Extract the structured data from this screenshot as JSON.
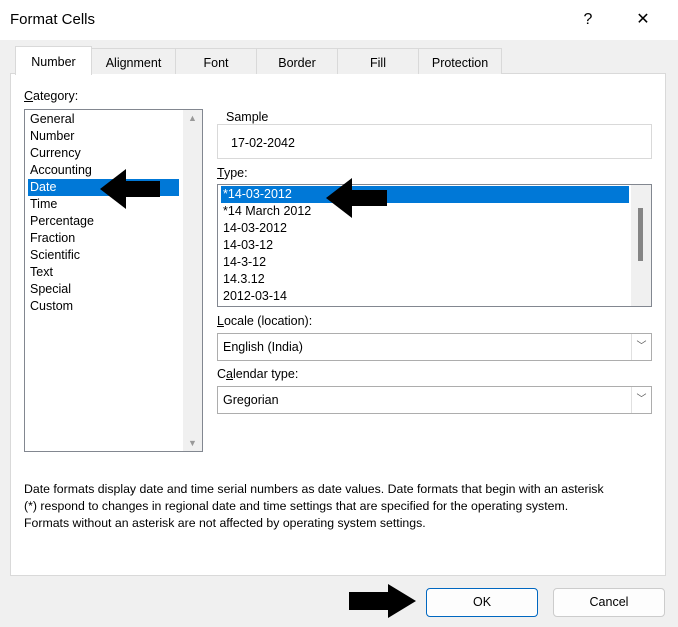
{
  "window": {
    "title": "Format Cells",
    "help": "?",
    "close": "✕"
  },
  "tabs": [
    "Number",
    "Alignment",
    "Font",
    "Border",
    "Fill",
    "Protection"
  ],
  "category": {
    "label_u": "C",
    "label_rest": "ategory:",
    "items": [
      "General",
      "Number",
      "Currency",
      "Accounting",
      "Date",
      "Time",
      "Percentage",
      "Fraction",
      "Scientific",
      "Text",
      "Special",
      "Custom"
    ],
    "selected": "Date"
  },
  "sample": {
    "label": "Sample",
    "value": "17-02-2042"
  },
  "type": {
    "label_u": "T",
    "label_rest": "ype:",
    "items": [
      "*14-03-2012",
      "*14 March 2012",
      "14-03-2012",
      "14-03-12",
      "14-3-12",
      "14.3.12",
      "2012-03-14"
    ],
    "selected": "*14-03-2012"
  },
  "locale": {
    "label_u": "L",
    "label_rest": "ocale (location):",
    "value": "English (India)"
  },
  "calendar": {
    "label_pre": "C",
    "label_u": "a",
    "label_rest": "lendar type:",
    "value": "Gregorian"
  },
  "description": [
    "Date formats display date and time serial numbers as date values.  Date formats that begin with an asterisk",
    "(*) respond to changes in regional date and time settings that are specified for the operating system.",
    "Formats without an asterisk are not affected by operating system settings."
  ],
  "buttons": {
    "ok": "OK",
    "cancel": "Cancel"
  }
}
